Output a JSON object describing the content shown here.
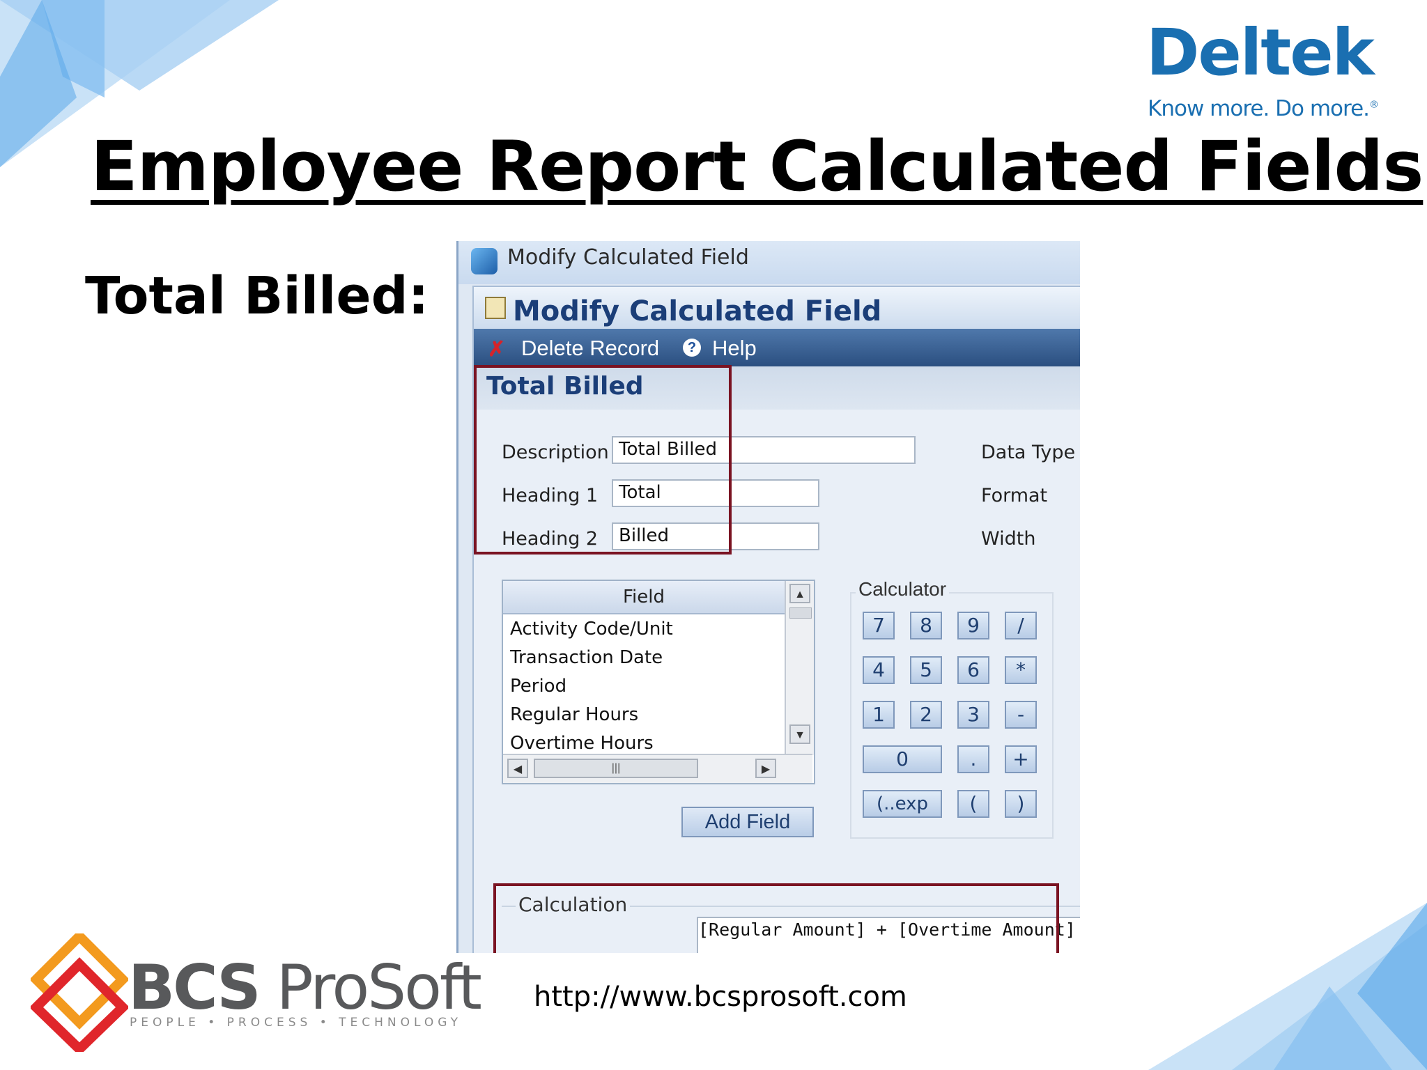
{
  "brand": {
    "name": "Deltek",
    "tagline": "Know more. Do more.",
    "registered": "®"
  },
  "slide": {
    "title": "Employee Report Calculated Fields",
    "subtitle": "Total Billed:",
    "url": "http://www.bcsprosoft.com"
  },
  "footer_logo": {
    "name_bold": "BCS",
    "name_rest": " ProSoft",
    "tagline": "PEOPLE • PROCESS • TECHNOLOGY"
  },
  "window": {
    "title": "Modify Calculated Field",
    "panel_title": "Modify Calculated Field",
    "toolbar": {
      "delete_label": "Delete Record",
      "help_label": "Help"
    },
    "record_title": "Total Billed",
    "form": {
      "description_label": "Description",
      "description_value": "Total Billed",
      "heading1_label": "Heading 1",
      "heading1_value": "Total",
      "heading2_label": "Heading 2",
      "heading2_value": "Billed",
      "data_type_label": "Data Type",
      "format_label": "Format",
      "width_label": "Width"
    },
    "field_list": {
      "header": "Field",
      "items": [
        "Activity Code/Unit",
        "Transaction Date",
        "Period",
        "Regular Hours",
        "Overtime Hours"
      ]
    },
    "add_field_label": "Add Field",
    "calculator": {
      "label": "Calculator",
      "keys": [
        "7",
        "8",
        "9",
        "/",
        "4",
        "5",
        "6",
        "*",
        "1",
        "2",
        "3",
        "-",
        "0",
        ".",
        "+",
        "(..exp",
        "(",
        ")"
      ]
    },
    "calculation": {
      "label": "Calculation",
      "value": "[Regular Amount] + [Overtime Amount]"
    }
  },
  "colors": {
    "deltek_blue": "#1a6fb1",
    "highlight_box": "#7a1322",
    "toolbar": "#2b4f80",
    "panel_title": "#1b3e78"
  }
}
